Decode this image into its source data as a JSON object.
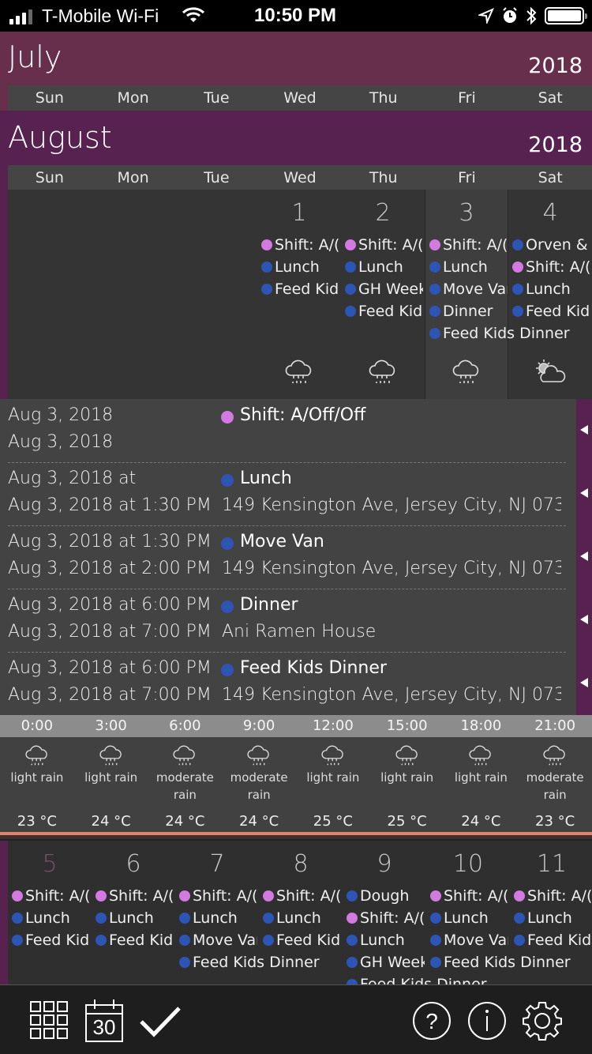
{
  "status_bar": {
    "carrier": "T-Mobile Wi-Fi",
    "time": "10:50 PM",
    "icons": [
      "signal-icon",
      "wifi-icon",
      "location-icon",
      "alarm-icon",
      "bluetooth-icon",
      "battery-icon"
    ]
  },
  "weekdays": [
    "Sun",
    "Mon",
    "Tue",
    "Wed",
    "Thu",
    "Fri",
    "Sat"
  ],
  "months": [
    {
      "name": "July",
      "year": "2018"
    },
    {
      "name": "August",
      "year": "2018"
    }
  ],
  "colors": {
    "pink": "#d27ae0",
    "blue": "#2c55b5",
    "accent_purple": "#572150",
    "july_band": "#672f4b"
  },
  "week1": {
    "days": [
      {
        "num": "1",
        "col": 3,
        "events": [
          {
            "c": "pink",
            "t": "Shift: A/("
          },
          {
            "c": "blue",
            "t": "Lunch"
          },
          {
            "c": "blue",
            "t": "Feed Kid"
          }
        ],
        "weather": "rain"
      },
      {
        "num": "2",
        "col": 4,
        "events": [
          {
            "c": "pink",
            "t": "Shift: A/("
          },
          {
            "c": "blue",
            "t": "Lunch"
          },
          {
            "c": "blue",
            "t": "GH Week"
          },
          {
            "c": "blue",
            "t": "Feed Kid"
          }
        ],
        "weather": "rain"
      },
      {
        "num": "3",
        "col": 5,
        "today": true,
        "events": [
          {
            "c": "pink",
            "t": "Shift: A/("
          },
          {
            "c": "blue",
            "t": "Lunch"
          },
          {
            "c": "blue",
            "t": "Move Van"
          },
          {
            "c": "blue",
            "t": "Dinner"
          },
          {
            "c": "blue",
            "t": "Feed Kids Dinner"
          }
        ],
        "weather": "rain"
      },
      {
        "num": "4",
        "col": 6,
        "events": [
          {
            "c": "blue",
            "t": "Orven &"
          },
          {
            "c": "pink",
            "t": "Shift: A/("
          },
          {
            "c": "blue",
            "t": "Lunch"
          },
          {
            "c": "blue",
            "t": "Feed Kid"
          }
        ],
        "weather": "partly-cloudy"
      }
    ]
  },
  "agenda": [
    {
      "start": "Aug 3, 2018",
      "end": "Aug 3, 2018",
      "title": "Shift: A/Off/Off",
      "color": "pink",
      "location": ""
    },
    {
      "start": "Aug 3, 2018 at",
      "end": "Aug 3, 2018 at 1:30 PM",
      "title": "Lunch",
      "color": "blue",
      "location": "149 Kensington Ave, Jersey City, NJ 073"
    },
    {
      "start": "Aug 3, 2018 at 1:30 PM",
      "end": "Aug 3, 2018 at 2:00 PM",
      "title": "Move Van",
      "color": "blue",
      "location": "149 Kensington Ave, Jersey City, NJ 073"
    },
    {
      "start": "Aug 3, 2018 at 6:00 PM",
      "end": "Aug 3, 2018 at 7:00 PM",
      "title": "Dinner",
      "color": "blue",
      "location": "Ani Ramen House"
    },
    {
      "start": "Aug 3, 2018 at 6:00 PM",
      "end": "Aug 3, 2018 at 7:00 PM",
      "title": "Feed Kids Dinner",
      "color": "blue",
      "location": "149 Kensington Ave, Jersey City, NJ 073"
    }
  ],
  "forecast": [
    {
      "time": "0:00",
      "cond": "light rain",
      "temp": "23 °C"
    },
    {
      "time": "3:00",
      "cond": "light rain",
      "temp": "24 °C"
    },
    {
      "time": "6:00",
      "cond": "moderate rain",
      "temp": "24 °C"
    },
    {
      "time": "9:00",
      "cond": "moderate rain",
      "temp": "24 °C"
    },
    {
      "time": "12:00",
      "cond": "light rain",
      "temp": "25 °C"
    },
    {
      "time": "15:00",
      "cond": "light rain",
      "temp": "25 °C"
    },
    {
      "time": "18:00",
      "cond": "light rain",
      "temp": "24 °C"
    },
    {
      "time": "21:00",
      "cond": "moderate rain",
      "temp": "23 °C"
    }
  ],
  "week2": {
    "days": [
      {
        "num": "5",
        "sunday": true,
        "events": [
          {
            "c": "pink",
            "t": "Shift: A/("
          },
          {
            "c": "blue",
            "t": "Lunch"
          },
          {
            "c": "blue",
            "t": "Feed Kid"
          }
        ]
      },
      {
        "num": "6",
        "events": [
          {
            "c": "pink",
            "t": "Shift: A/("
          },
          {
            "c": "blue",
            "t": "Lunch"
          },
          {
            "c": "blue",
            "t": "Feed Kid"
          }
        ]
      },
      {
        "num": "7",
        "events": [
          {
            "c": "pink",
            "t": "Shift: A/("
          },
          {
            "c": "blue",
            "t": "Lunch"
          },
          {
            "c": "blue",
            "t": "Move Van"
          },
          {
            "c": "blue",
            "t": "Feed Kids Dinner"
          }
        ]
      },
      {
        "num": "8",
        "events": [
          {
            "c": "pink",
            "t": "Shift: A/("
          },
          {
            "c": "blue",
            "t": "Lunch"
          },
          {
            "c": "blue",
            "t": "Feed Kid"
          }
        ]
      },
      {
        "num": "9",
        "events": [
          {
            "c": "blue",
            "t": "Dough"
          },
          {
            "c": "pink",
            "t": "Shift: A/("
          },
          {
            "c": "blue",
            "t": "Lunch"
          },
          {
            "c": "blue",
            "t": "GH Week"
          },
          {
            "c": "blue",
            "t": "Feed Kids Dinner"
          }
        ]
      },
      {
        "num": "10",
        "events": [
          {
            "c": "pink",
            "t": "Shift: A/("
          },
          {
            "c": "blue",
            "t": "Lunch"
          },
          {
            "c": "blue",
            "t": "Move Van"
          },
          {
            "c": "blue",
            "t": "Feed Kids Dinner"
          }
        ]
      },
      {
        "num": "11",
        "events": [
          {
            "c": "pink",
            "t": "Shift: A/("
          },
          {
            "c": "blue",
            "t": "Lunch"
          },
          {
            "c": "blue",
            "t": "Feed Kid"
          }
        ]
      }
    ]
  },
  "toolbar": {
    "calendar_day_number": "30",
    "left_icons": [
      "grid-view-icon",
      "calendar-icon",
      "checkmark-icon"
    ],
    "right_icons": [
      "help-icon",
      "info-icon",
      "settings-icon"
    ]
  }
}
